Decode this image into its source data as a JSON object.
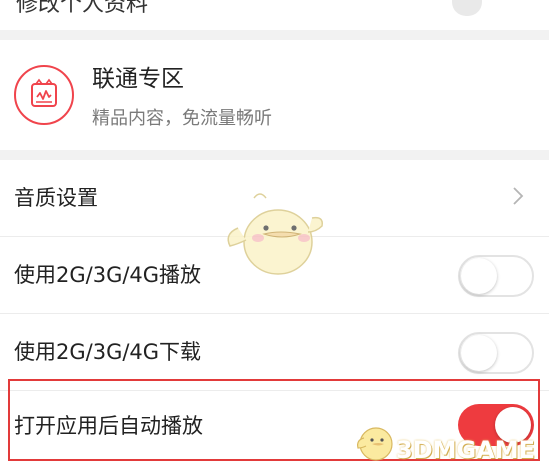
{
  "top_row": {
    "label": "修改个人资料"
  },
  "unicom": {
    "title": "联通专区",
    "subtitle": "精品内容，免流量畅听"
  },
  "settings": {
    "audio_quality": {
      "label": "音质设置"
    },
    "play_on_mobile": {
      "label": "使用2G/3G/4G播放",
      "enabled": false
    },
    "download_on_mobile": {
      "label": "使用2G/3G/4G下载",
      "enabled": false
    },
    "autoplay_on_open": {
      "label": "打开应用后自动播放",
      "enabled": true
    }
  },
  "colors": {
    "accent": "#ee3b3f",
    "logo_red": "#f0444c",
    "highlight": "#e23a3a"
  },
  "icons": {
    "logo": "unicom-music-icon",
    "chevron": "chevron-right-icon"
  },
  "watermark": "3DMGAME"
}
